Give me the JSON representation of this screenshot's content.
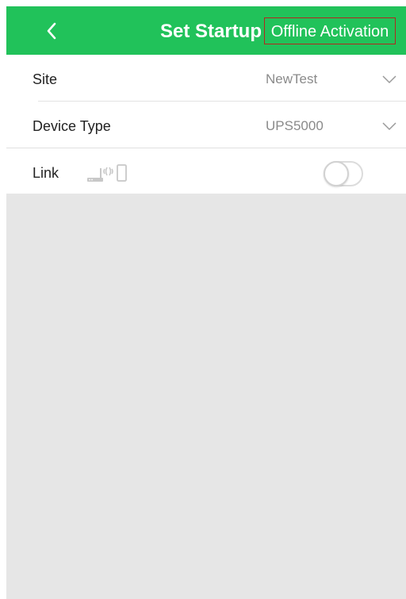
{
  "header": {
    "title": "Set Startup",
    "offline_label": "Offline Activation",
    "back_icon": "chevron-left-icon",
    "accent": "#21c25a"
  },
  "form": {
    "site": {
      "label": "Site",
      "value": "NewTest",
      "icon": "chevron-down-icon"
    },
    "device_type": {
      "label": "Device Type",
      "value": "UPS5000",
      "icon": "chevron-down-icon"
    },
    "link": {
      "label": "Link",
      "icon": "router-signal-phone-icon",
      "toggle_on": false
    }
  }
}
